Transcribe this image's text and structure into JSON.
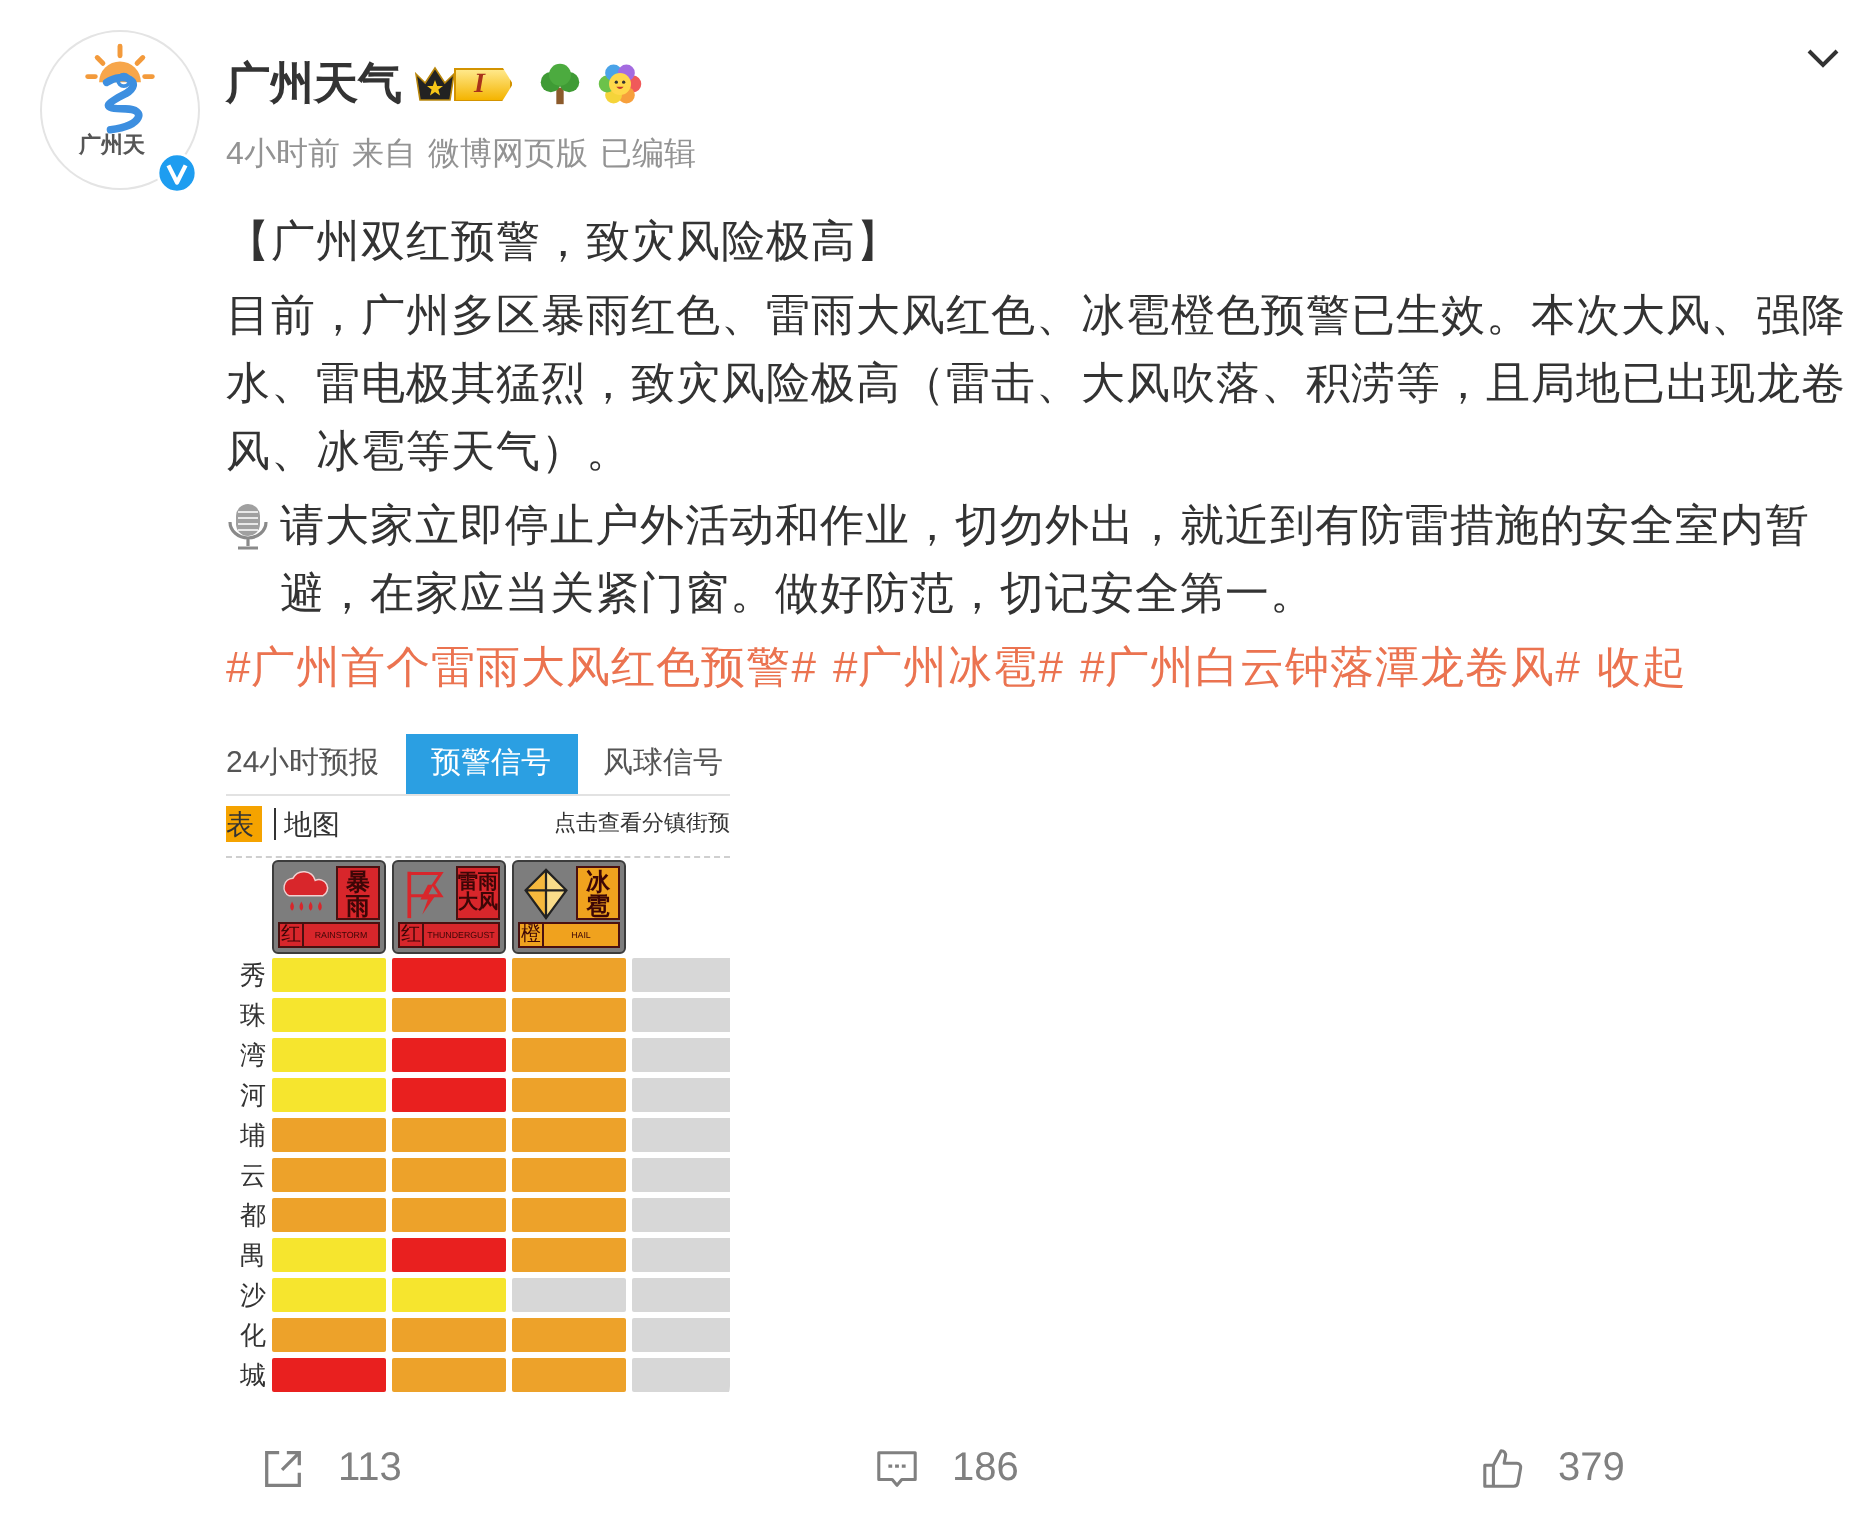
{
  "author": {
    "name": "广州天气",
    "avatar_caption": "广州天",
    "verified": true,
    "level_badge": "I"
  },
  "meta": {
    "time": "4小时前",
    "source_prefix": "来自",
    "source": "微博网页版",
    "edited": "已编辑"
  },
  "content": {
    "paragraphs": [
      {
        "kind": "plain",
        "text": "【广州双红预警，致灾风险极高】"
      },
      {
        "kind": "plain",
        "text": "目前，广州多区暴雨红色、雷雨大风红色、冰雹橙色预警已生效。本次大风、强降水、雷电极其猛烈，致灾风险极高（雷击、大风吹落、积涝等，且局地已出现龙卷风、冰雹等天气）。"
      },
      {
        "kind": "mic",
        "text": "请大家立即停止户外活动和作业，切勿外出，就近到有防雷措施的安全室内暂避，在家应当关紧门窗。做好防范，切记安全第一。"
      }
    ],
    "hashtags": [
      "#广州首个雷雨大风红色预警#",
      "#广州冰雹#",
      "#广州白云钟落潭龙卷风#"
    ],
    "collapse_link": "收起"
  },
  "image": {
    "tabs": [
      {
        "label": "24小时预报",
        "selected": false
      },
      {
        "label": "预警信号",
        "selected": true
      },
      {
        "label": "风球信号",
        "selected": false
      }
    ],
    "view_toggle": [
      {
        "label": "表",
        "selected": true
      },
      {
        "label": "地图",
        "selected": false
      }
    ],
    "hint": "点击查看分镇街预",
    "signals": [
      {
        "kind": "rainstorm",
        "name": "暴雨",
        "level_char": "红",
        "english": "RAINSTORM",
        "color": "#d8262b"
      },
      {
        "kind": "thunder_gust",
        "name": "雷雨大风",
        "level_char": "红",
        "english": "THUNDERGUST",
        "color": "#d8262b"
      },
      {
        "kind": "hail",
        "name": "冰雹",
        "level_char": "橙",
        "english": "HAIL",
        "color": "#f0a21e"
      }
    ],
    "districts": [
      {
        "label": "秀",
        "cells": [
          {
            "color": "#f6e52e"
          },
          {
            "color": "#e9201f"
          },
          {
            "color": "#eda22a"
          },
          {
            "color": "#d7d7d7"
          }
        ]
      },
      {
        "label": "珠",
        "cells": [
          {
            "color": "#f6e52e"
          },
          {
            "color": "#eda22a"
          },
          {
            "color": "#eda22a"
          },
          {
            "color": "#d7d7d7"
          }
        ]
      },
      {
        "label": "湾",
        "cells": [
          {
            "color": "#f6e52e"
          },
          {
            "color": "#e9201f"
          },
          {
            "color": "#eda22a"
          },
          {
            "color": "#d7d7d7"
          }
        ]
      },
      {
        "label": "河",
        "cells": [
          {
            "color": "#f6e52e"
          },
          {
            "color": "#e9201f"
          },
          {
            "color": "#eda22a"
          },
          {
            "color": "#d7d7d7"
          }
        ]
      },
      {
        "label": "埔",
        "cells": [
          {
            "color": "#eda22a"
          },
          {
            "color": "#eda22a"
          },
          {
            "color": "#eda22a"
          },
          {
            "color": "#d7d7d7"
          }
        ]
      },
      {
        "label": "云",
        "cells": [
          {
            "color": "#eda22a"
          },
          {
            "color": "#eda22a"
          },
          {
            "color": "#eda22a"
          },
          {
            "color": "#d7d7d7"
          }
        ]
      },
      {
        "label": "都",
        "cells": [
          {
            "color": "#eda22a"
          },
          {
            "color": "#eda22a"
          },
          {
            "color": "#eda22a"
          },
          {
            "color": "#d7d7d7"
          }
        ]
      },
      {
        "label": "禺",
        "cells": [
          {
            "color": "#f6e52e"
          },
          {
            "color": "#e9201f"
          },
          {
            "color": "#eda22a"
          },
          {
            "color": "#d7d7d7"
          }
        ]
      },
      {
        "label": "沙",
        "cells": [
          {
            "color": "#f6e52e"
          },
          {
            "color": "#f6e52e"
          },
          {
            "color": "#d7d7d7"
          },
          {
            "color": "#d7d7d7"
          }
        ]
      },
      {
        "label": "化",
        "cells": [
          {
            "color": "#eda22a"
          },
          {
            "color": "#eda22a"
          },
          {
            "color": "#eda22a"
          },
          {
            "color": "#d7d7d7"
          }
        ]
      },
      {
        "label": "城",
        "cells": [
          {
            "color": "#e9201f"
          },
          {
            "color": "#eda22a"
          },
          {
            "color": "#eda22a"
          },
          {
            "color": "#d7d7d7"
          }
        ]
      }
    ]
  },
  "actions": [
    {
      "kind": "share",
      "count": "113"
    },
    {
      "kind": "comment",
      "count": "186"
    },
    {
      "kind": "like",
      "count": "379"
    }
  ]
}
